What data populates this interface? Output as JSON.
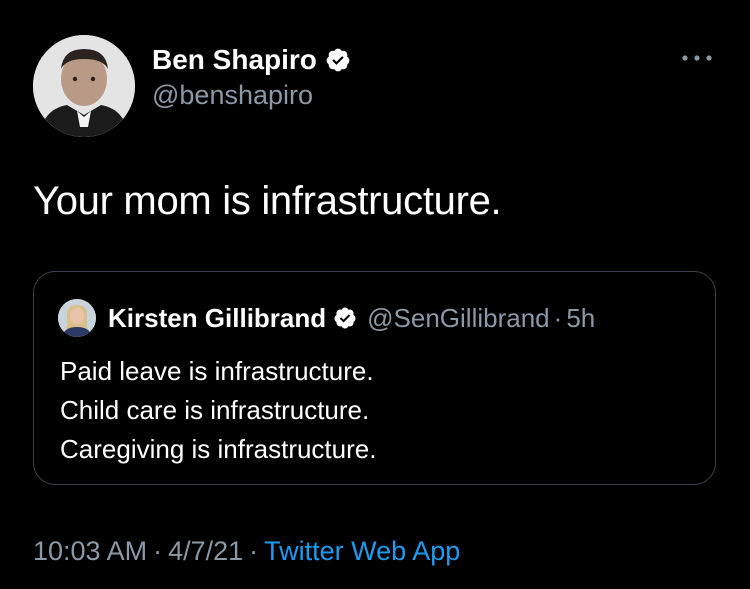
{
  "tweet": {
    "author": {
      "name": "Ben Shapiro",
      "handle": "@benshapiro",
      "verified": true,
      "avatar_icon": "user-avatar-icon"
    },
    "text": "Your mom is infrastructure.",
    "more_icon": "more-options-icon",
    "quoted": {
      "author": {
        "name": "Kirsten Gillibrand",
        "handle": "@SenGillibrand",
        "verified": true,
        "avatar_icon": "user-avatar-icon"
      },
      "separator": "·",
      "time": "5h",
      "lines": [
        "Paid leave is infrastructure.",
        "Child care is infrastructure.",
        "Caregiving is infrastructure."
      ]
    },
    "meta": {
      "time": "10:03 AM",
      "date": "4/7/21",
      "separator": "·",
      "source": "Twitter Web App"
    }
  },
  "colors": {
    "background": "#000000",
    "text": "#ffffff",
    "secondary_text": "#8b98a5",
    "link": "#1d9bf0",
    "border": "#38444d",
    "verified_badge": "#ffffff"
  }
}
